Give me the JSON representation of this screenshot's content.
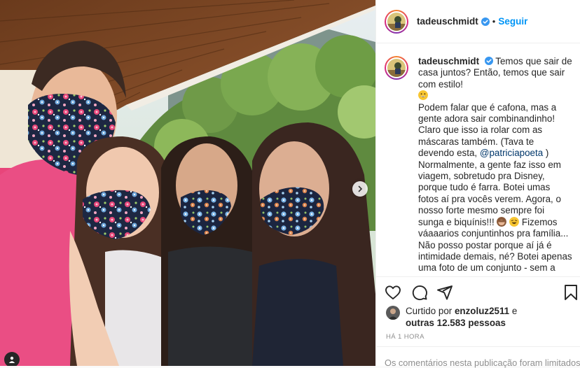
{
  "account": {
    "username": "tadeuschmidt",
    "follow_label": "Seguir",
    "separator": "•"
  },
  "caption": {
    "lines": [
      "Temos que sair de casa juntos? Então, temos que sair com estilo!"
    ],
    "p2": "Podem falar que é cafona, mas a gente adora sair combinandinho! Claro que isso ia rolar com as máscaras também. (Tava te devendo esta,",
    "mention": "@patriciapoeta",
    "p2_end": ")",
    "p3": "Normalmente, a gente faz isso em viagem, sobretudo pra Disney, porque tudo é farra. Botei umas fotos aí pra vocês verem. Agora, o nosso forte mesmo sempre foi sunga e biquínis!!!",
    "p3_cont": "Fizemos váaaarios conjuntinhos pra família... Não posso postar porque aí já é intimidade demais, né? Botei apenas uma foto de um conjunto - sem a gente dentro, claro - que a gente usou uma vez"
  },
  "likes": {
    "prefix": "Curtido por",
    "liker": "enzoluz2511",
    "conj": "e",
    "others": "outras 12.583 pessoas"
  },
  "time_ago": "HÁ 1 HORA",
  "comments_limited": "Os comentários nesta publicação foram limitados.",
  "icons": {
    "like": "heart-icon",
    "comment": "comment-icon",
    "share": "paper-plane-icon",
    "save": "bookmark-icon",
    "verified": "verified-badge-icon",
    "next": "chevron-right-icon",
    "tag": "user-tag-icon"
  },
  "colors": {
    "follow_blue": "#0095f6",
    "verified_blue": "#3897f0",
    "muted": "#8e8e8e",
    "text": "#262626"
  }
}
